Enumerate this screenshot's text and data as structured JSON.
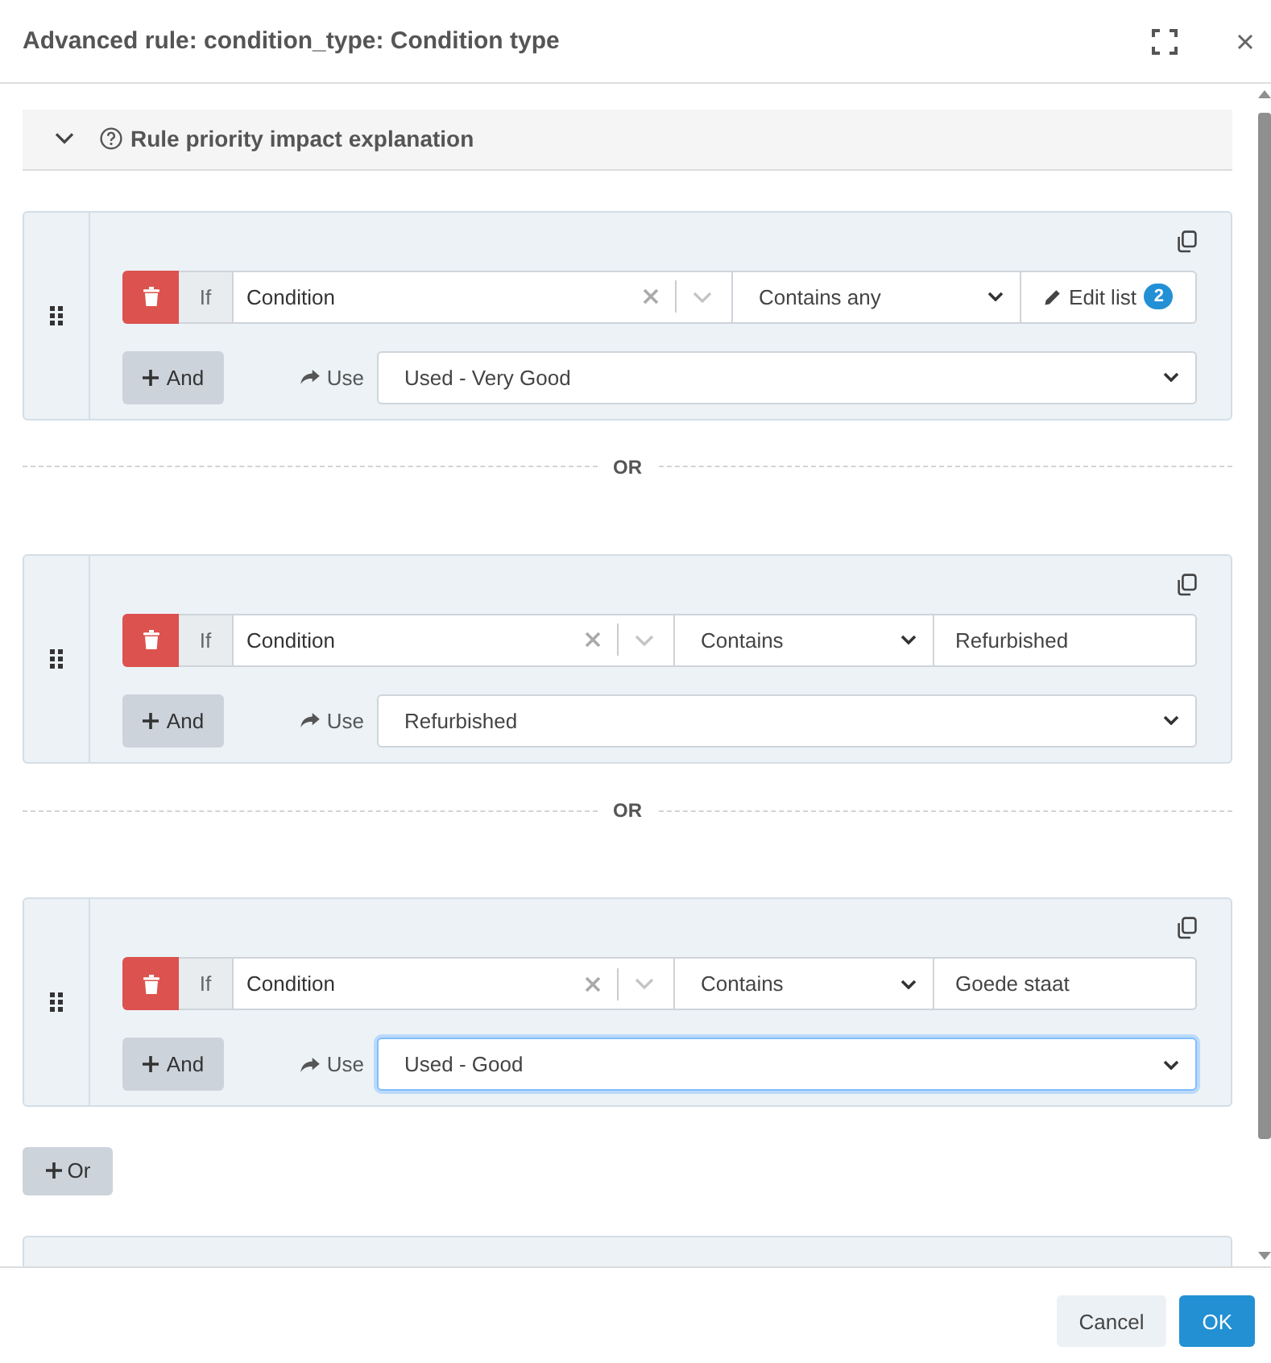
{
  "dialog": {
    "title": "Advanced rule: condition_type: Condition type"
  },
  "explanation": {
    "label": "Rule priority impact explanation",
    "expanded": false
  },
  "rules": [
    {
      "conditions": [
        {
          "prefix": "If",
          "field": "Condition",
          "operator": "Contains any",
          "value": {
            "kind": "list",
            "label": "Edit list",
            "count": "2"
          }
        }
      ],
      "and_button": "And",
      "use_label": "Use",
      "result": {
        "value": "Used - Very Good",
        "focused": false
      }
    },
    {
      "conditions": [
        {
          "prefix": "If",
          "field": "Condition",
          "operator": "Contains",
          "value": {
            "kind": "text",
            "text": "Refurbished"
          }
        }
      ],
      "and_button": "And",
      "use_label": "Use",
      "result": {
        "value": "Refurbished",
        "focused": false
      }
    },
    {
      "conditions": [
        {
          "prefix": "If",
          "field": "Condition",
          "operator": "Contains",
          "value": {
            "kind": "text",
            "text": "Goede staat"
          }
        }
      ],
      "and_button": "And",
      "use_label": "Use",
      "result": {
        "value": "Used - Good",
        "focused": true
      }
    }
  ],
  "separators": [
    "OR",
    "OR"
  ],
  "add_or_button": "Or",
  "rules_continue_below": true,
  "footer": {
    "buttons": [
      {
        "label": "Cancel",
        "kind": "secondary"
      },
      {
        "label": "OK",
        "kind": "primary"
      }
    ]
  }
}
